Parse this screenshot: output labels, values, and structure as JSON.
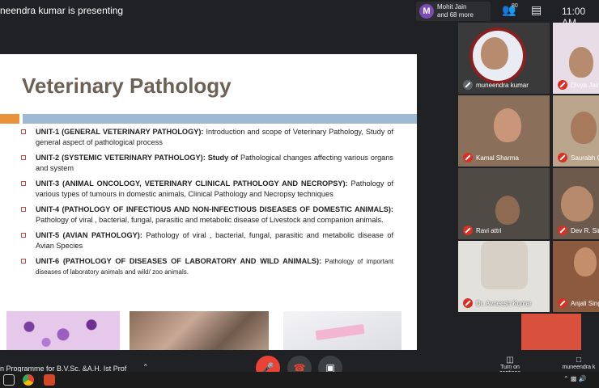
{
  "header": {
    "presenting": "neendra kumar is presenting",
    "people_avatar": "M",
    "people_line1": "Mohit Jain",
    "people_line2": "and 68 more",
    "participants_count": "80",
    "clock": "11:00 AM"
  },
  "slide": {
    "title": "Veterinary Pathology",
    "units": [
      {
        "head": "UNIT-1 (GENERAL VETERINARY PATHOLOGY):",
        "body": " Introduction and scope of Veterinary Pathology, Study of general aspect of pathological process"
      },
      {
        "head": "UNIT-2 (SYSTEMIC VETERINARY PATHOLOGY): Study of",
        "body": " Pathological changes affecting various organs and system"
      },
      {
        "head": "UNIT-3 (ANIMAL ONCOLOGY, VETERINARY CLINICAL PATHOLOGY AND NECROPSY):",
        "body": " Pathology of various types of tumours in domestic animals, Clinical Pathology and Necropsy techniques"
      },
      {
        "head": "UNIT-4 (PATHOLOGY OF INFECTIOUS AND NON-INFECTIOUS DISEASES OF DOMESTIC ANIMALS):",
        "body": " Pathology of viral , bacterial, fungal, parasitic and metabolic disease of Livestock and companion animals."
      },
      {
        "head": "UNIT-5 (AVIAN PATHOLOGY):",
        "body": " Pathology of viral , bacterial, fungal, parasitic and metabolic disease of Avian Species"
      },
      {
        "head": "UNIT-6 (PATHOLOGY OF DISEASES OF LABORATORY AND WILD ANIMALS):",
        "body": " Pathology of important diseases of laboratory animals and wild/ zoo animals."
      }
    ]
  },
  "participants": [
    {
      "name": "muneendra kumar"
    },
    {
      "name": "Divya Jain"
    },
    {
      "name": "Kamal Sharma"
    },
    {
      "name": "Saurabh Ch"
    },
    {
      "name": "Ravi attri"
    },
    {
      "name": "Dev R. Singh"
    },
    {
      "name": "Dr. Avneesh Kumar"
    },
    {
      "name": "Anjali Singh"
    }
  ],
  "footer": {
    "meeting_title": "n Programme for B.V.Sc. &A.H. Ist Prof",
    "captions_label": "Turn on captions",
    "present_label": "muneendra k"
  },
  "colors": {
    "mic_off": "#d93025",
    "end_call": "#ea4335",
    "bullet": "#c0504d"
  }
}
